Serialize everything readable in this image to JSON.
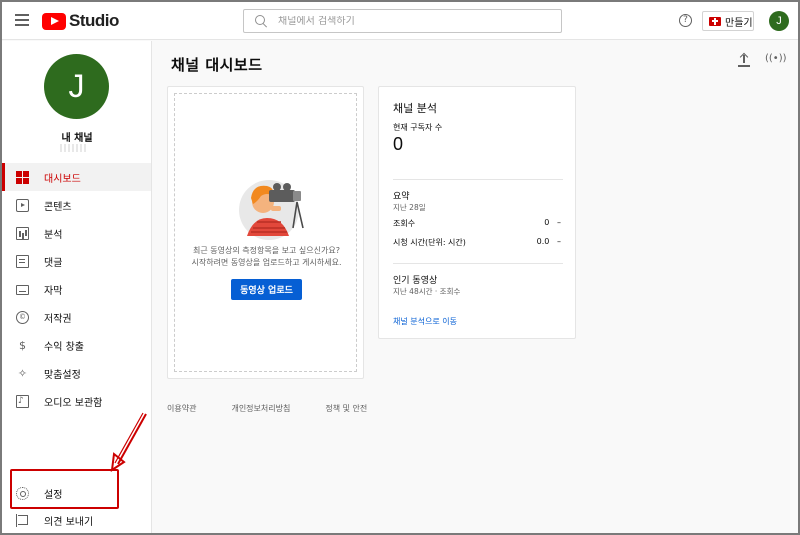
{
  "app": {
    "logo_text": "Studio",
    "avatar_initial": "J"
  },
  "search": {
    "placeholder": "채널에서 검색하기"
  },
  "topbar": {
    "help_glyph": "?",
    "create_label": "만들기"
  },
  "sidebar": {
    "channel_title": "내 채널",
    "items": [
      {
        "label": "대시보드",
        "icon": "dashboard-icon",
        "active": true
      },
      {
        "label": "콘텐츠",
        "icon": "content-icon"
      },
      {
        "label": "분석",
        "icon": "analytics-icon"
      },
      {
        "label": "댓글",
        "icon": "comments-icon"
      },
      {
        "label": "자막",
        "icon": "subtitles-icon"
      },
      {
        "label": "저작권",
        "icon": "copyright-icon"
      },
      {
        "label": "수익 창출",
        "icon": "dollar-icon"
      },
      {
        "label": "맞춤설정",
        "icon": "magic-wand-icon"
      },
      {
        "label": "오디오 보관함",
        "icon": "audio-library-icon"
      }
    ],
    "settings_label": "설정",
    "feedback_label": "의견 보내기",
    "copyright_glyph": "©",
    "dollar_glyph": "$",
    "wand_glyph": "✧"
  },
  "main": {
    "page_title": "채널 대시보드",
    "live_glyph": "((•))",
    "upload_card": {
      "text_line1": "최근 동영상의 측정항목을 보고 싶으신가요?",
      "text_line2": "시작하려면 동영상을 업로드하고 게시하세요.",
      "button_label": "동영상 업로드"
    },
    "analytics_card": {
      "title": "채널 분석",
      "subscribers_label": "현재 구독자 수",
      "subscribers_value": "0",
      "summary_title": "요약",
      "summary_period": "지난 28일",
      "views_label": "조회수",
      "views_value": "0",
      "watch_time_label": "시청 시간(단위: 시간)",
      "watch_time_value": "0.0",
      "trend_glyph": "–",
      "popular_title": "인기 동영상",
      "popular_sub": "지난 48시간 · 조회수",
      "link_label": "채널 분석으로 이동"
    },
    "footer": {
      "terms": "이용약관",
      "privacy": "개인정보처리방침",
      "policy": "정책 및 안전"
    }
  },
  "colors": {
    "accent_red": "#cc0000",
    "brand_red": "#ff0000",
    "link_blue": "#065fd4",
    "avatar_green": "#2e6b1e"
  }
}
